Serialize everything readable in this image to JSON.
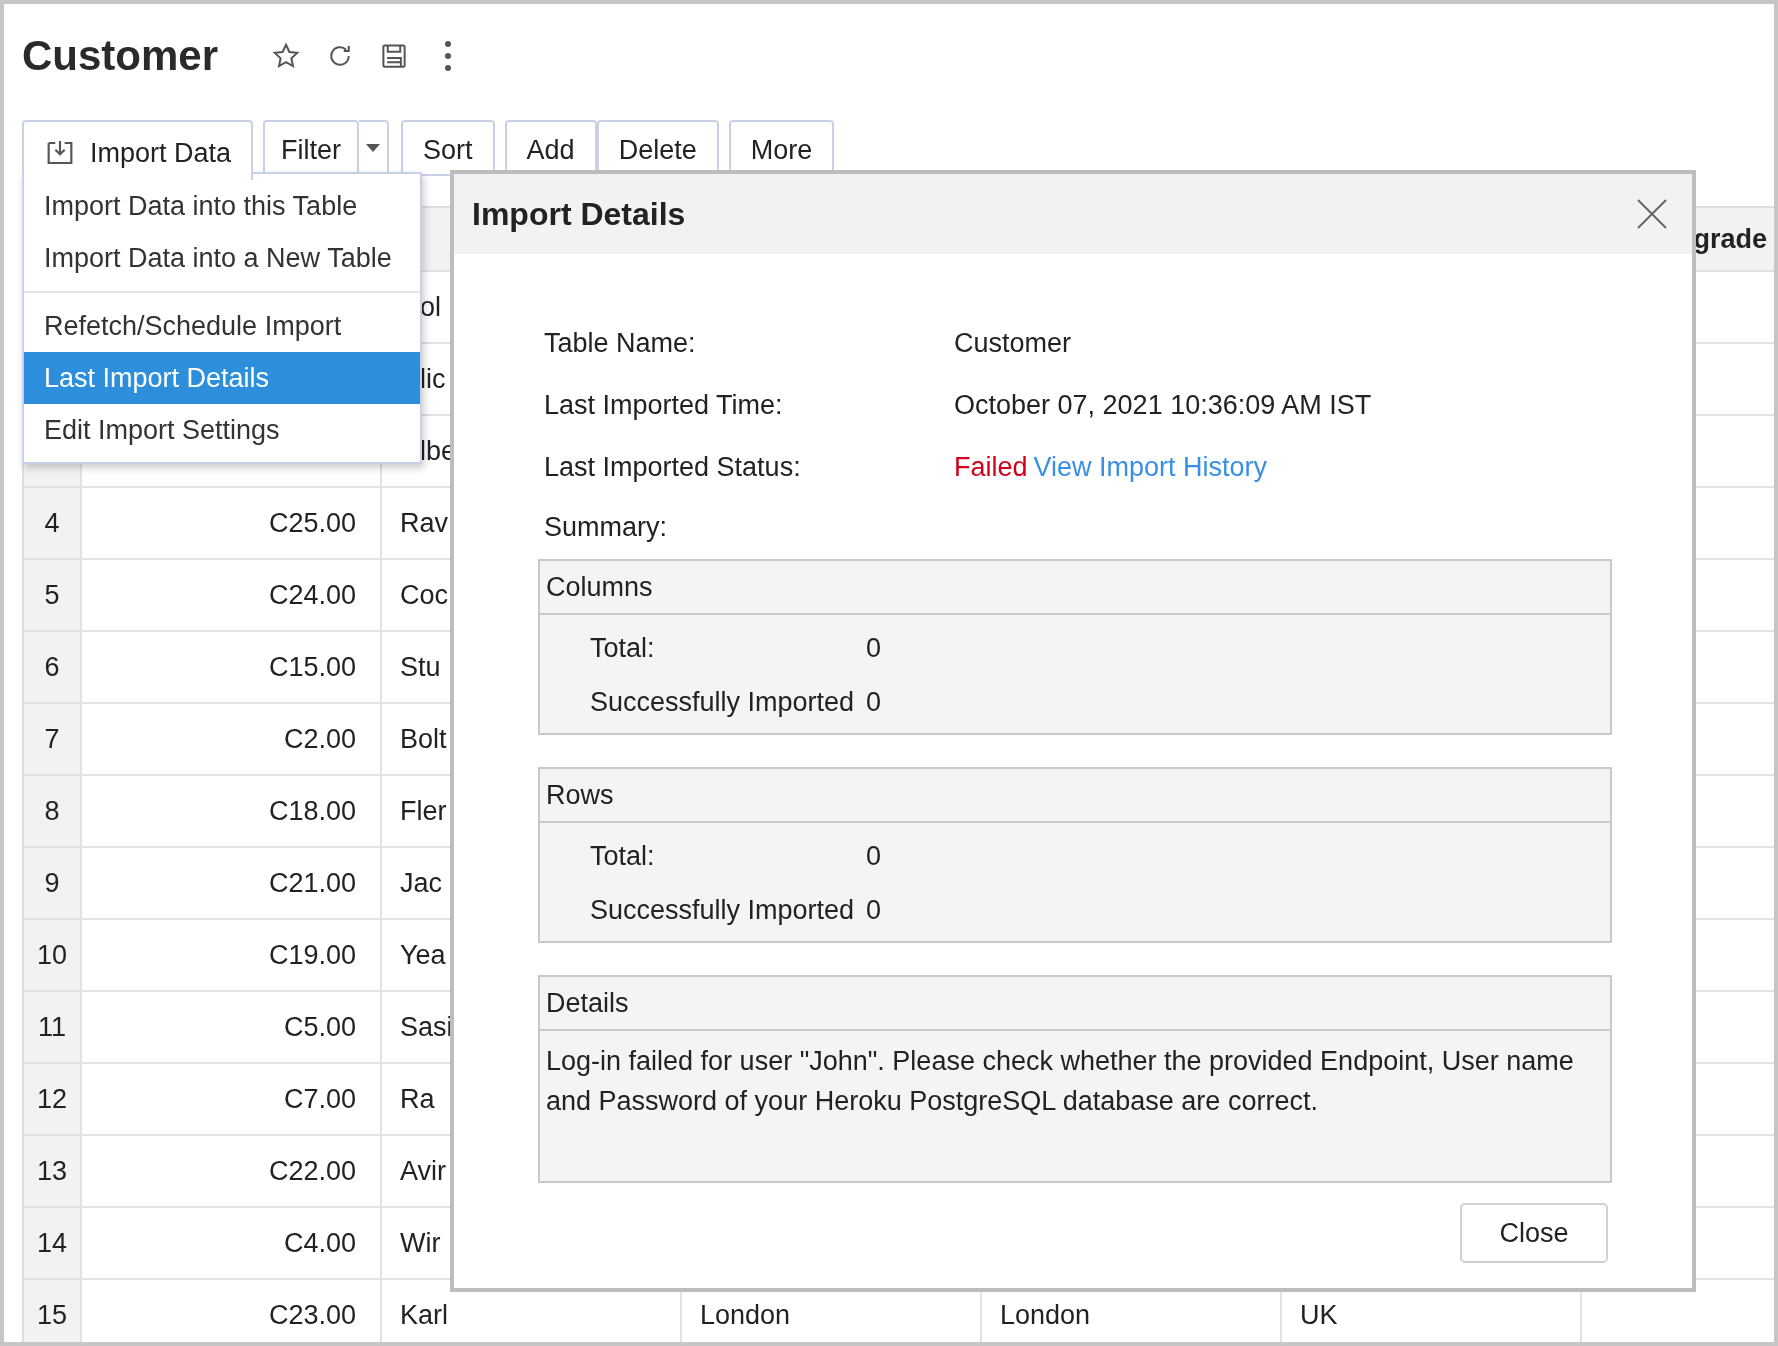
{
  "page": {
    "title": "Customer"
  },
  "toolbar": [
    {
      "label": "Import Data",
      "kind": "import",
      "open": true
    },
    {
      "label": "Filter",
      "kind": "split",
      "open": false
    },
    {
      "label": "Sort",
      "kind": "plain",
      "open": false
    },
    {
      "label": "Add",
      "kind": "joined",
      "open": false
    },
    {
      "label": "Delete",
      "kind": "joined",
      "open": false
    },
    {
      "label": "More",
      "kind": "plain",
      "open": false
    }
  ],
  "import_menu": [
    {
      "items": [
        {
          "label": "Import Data into this Table",
          "selected": false
        },
        {
          "label": "Import Data into a New Table",
          "selected": false
        }
      ]
    },
    {
      "items": [
        {
          "label": "Refetch/Schedule Import",
          "selected": false
        },
        {
          "label": "Last Import Details",
          "selected": true
        },
        {
          "label": "Edit Import Settings",
          "selected": false
        }
      ]
    }
  ],
  "table": {
    "column_7_header": "grade",
    "rows": [
      {
        "name": "ol"
      },
      {
        "name": "lic"
      },
      {
        "name": "lbe"
      },
      {
        "number": "4",
        "amount": "C25.00",
        "name": "Rav"
      },
      {
        "number": "5",
        "amount": "C24.00",
        "name": "Coc"
      },
      {
        "number": "6",
        "amount": "C15.00",
        "name": "Stu"
      },
      {
        "number": "7",
        "amount": "C2.00",
        "name": "Bolt"
      },
      {
        "number": "8",
        "amount": "C18.00",
        "name": "Fler"
      },
      {
        "number": "9",
        "amount": "C21.00",
        "name": "Jac"
      },
      {
        "number": "10",
        "amount": "C19.00",
        "name": "Yea"
      },
      {
        "number": "11",
        "amount": "C5.00",
        "name": "Sasi"
      },
      {
        "number": "12",
        "amount": "C7.00",
        "name": "Ra"
      },
      {
        "number": "13",
        "amount": "C22.00",
        "name": "Avir"
      },
      {
        "number": "14",
        "amount": "C4.00",
        "name": "Wir"
      },
      {
        "number": "15",
        "amount": "C23.00",
        "name": "Karl",
        "column_4": "London",
        "column_5": "London",
        "column_6": "UK"
      }
    ]
  },
  "dialog": {
    "title": "Import Details",
    "fields": [
      {
        "label": "Table Name:",
        "value": "Customer"
      },
      {
        "label": "Last Imported Time:",
        "value": "October 07, 2021 10:36:09 AM IST"
      }
    ],
    "status": {
      "label": "Last Imported Status:",
      "value": "Failed",
      "link": "View Import History"
    },
    "summary_label": "Summary:",
    "sections": [
      {
        "title": "Columns",
        "items": [
          {
            "label": "Total:",
            "value": "0"
          },
          {
            "label": "Successfully Imported",
            "value": "0"
          }
        ]
      },
      {
        "title": "Rows",
        "items": [
          {
            "label": "Total:",
            "value": "0"
          },
          {
            "label": "Successfully Imported",
            "value": "0"
          }
        ]
      }
    ],
    "details": {
      "title": "Details",
      "text": "Log-in failed for user \"John\". Please check whether the provided Endpoint, User name and Password of your Heroku PostgreSQL database are correct."
    },
    "close_button": "Close"
  }
}
